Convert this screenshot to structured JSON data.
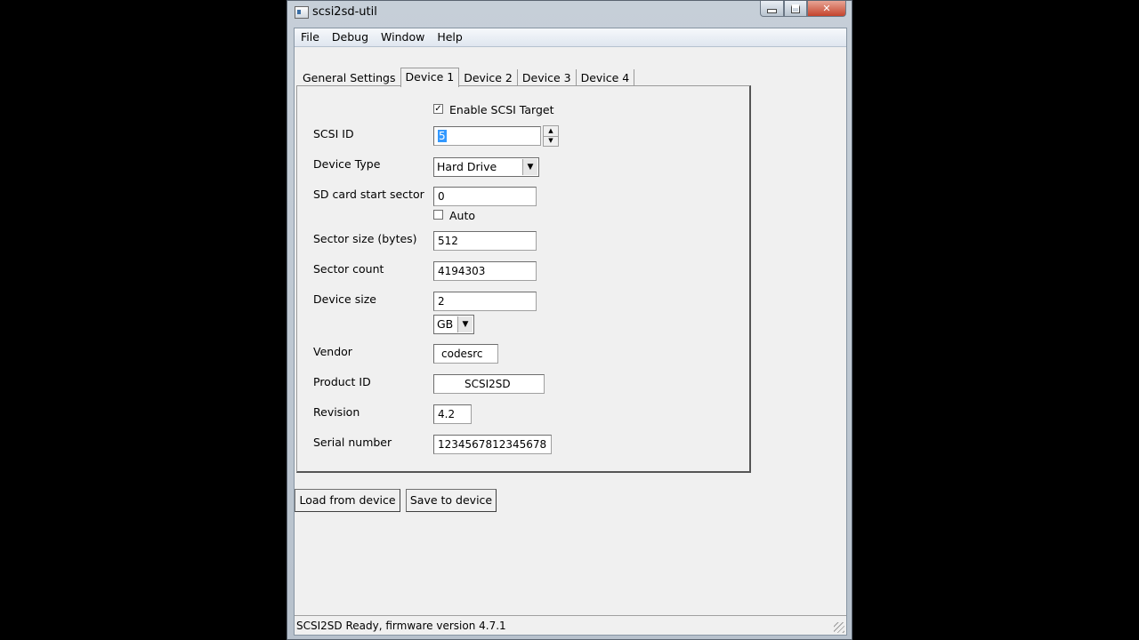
{
  "window": {
    "title": "scsi2sd-util"
  },
  "menu": [
    "File",
    "Debug",
    "Window",
    "Help"
  ],
  "tabs": [
    "General Settings",
    "Device 1",
    "Device 2",
    "Device 3",
    "Device 4"
  ],
  "active_tab": "Device 1",
  "device": {
    "enable_label": "Enable SCSI Target",
    "enable_checked": true,
    "scsi_id_label": "SCSI ID",
    "scsi_id_value": "5",
    "device_type_label": "Device Type",
    "device_type_value": "Hard Drive",
    "start_sector_label": "SD card start sector",
    "start_sector_value": "0",
    "auto_label": "Auto",
    "auto_checked": false,
    "sector_size_label": "Sector size (bytes)",
    "sector_size_value": "512",
    "sector_count_label": "Sector count",
    "sector_count_value": "4194303",
    "device_size_label": "Device size",
    "device_size_value": "2",
    "device_size_unit": "GB",
    "vendor_label": "Vendor",
    "vendor_value": "codesrc",
    "product_label": "Product ID",
    "product_value": "SCSI2SD",
    "revision_label": "Revision",
    "revision_value": "4.2",
    "serial_label": "Serial number",
    "serial_value": "1234567812345678"
  },
  "buttons": {
    "load": "Load from device",
    "save": "Save to device"
  },
  "status": "SCSI2SD Ready, firmware version 4.7.1"
}
